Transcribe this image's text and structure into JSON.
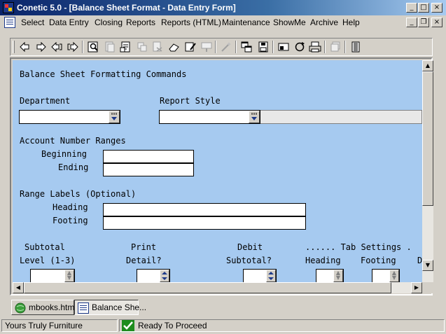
{
  "window": {
    "title": "Conetic 5.0 - [Balance Sheet Format - Data Entry Form]",
    "controls": {
      "minimize": "_",
      "maximize": "□",
      "close": "×"
    },
    "mdi_controls": {
      "minimize": "_",
      "restore": "❐",
      "close": "×"
    }
  },
  "menu": {
    "items": [
      "Select",
      "Data Entry",
      "Closing",
      "Reports",
      "Reports (HTML)",
      "Maintenance",
      "ShowMe",
      "Archive",
      "Help"
    ]
  },
  "toolbar": {
    "icons": [
      "first-record-icon",
      "next-record-icon",
      "previous-record-icon",
      "last-record-icon",
      "find-icon",
      "copy-record-icon",
      "add-record-icon",
      "duplicate-icon",
      "delete-icon",
      "erase-icon",
      "edit-icon",
      "post-icon",
      "wand-icon",
      "window-icon",
      "save-icon",
      "print-preview-icon",
      "refresh-icon",
      "printer-icon",
      "stack-icon",
      "exit-icon"
    ]
  },
  "form": {
    "heading": "Balance Sheet Formatting Commands",
    "department": {
      "label": "Department",
      "value": ""
    },
    "report_style": {
      "label": "Report Style",
      "value": ""
    },
    "account_ranges": {
      "label": "Account Number Ranges",
      "beginning": {
        "label": "Beginning",
        "value": ""
      },
      "ending": {
        "label": "Ending",
        "value": ""
      }
    },
    "range_labels": {
      "label": "Range Labels (Optional)",
      "heading": {
        "label": "Heading",
        "value": ""
      },
      "footing": {
        "label": "Footing",
        "value": ""
      }
    },
    "bottom": {
      "subtotal_top": "Subtotal",
      "subtotal_bottom": "Level (1-3)",
      "print_top": "Print",
      "print_bottom": "Detail?",
      "debit_top": "Debit",
      "debit_bottom": "Subtotal?",
      "tab_settings": "...... Tab Settings .",
      "tab_heading": "Heading",
      "tab_footing": "Footing",
      "tab_d": "D"
    }
  },
  "taskbar": {
    "tabs": [
      {
        "label": "mbooks.html",
        "icon": "browser-icon"
      },
      {
        "label": "Balance She...",
        "icon": "form-window-icon"
      }
    ]
  },
  "status": {
    "company": "Yours Truly Furniture",
    "message": "Ready To Proceed",
    "ok_color": "#1e8c1e"
  }
}
